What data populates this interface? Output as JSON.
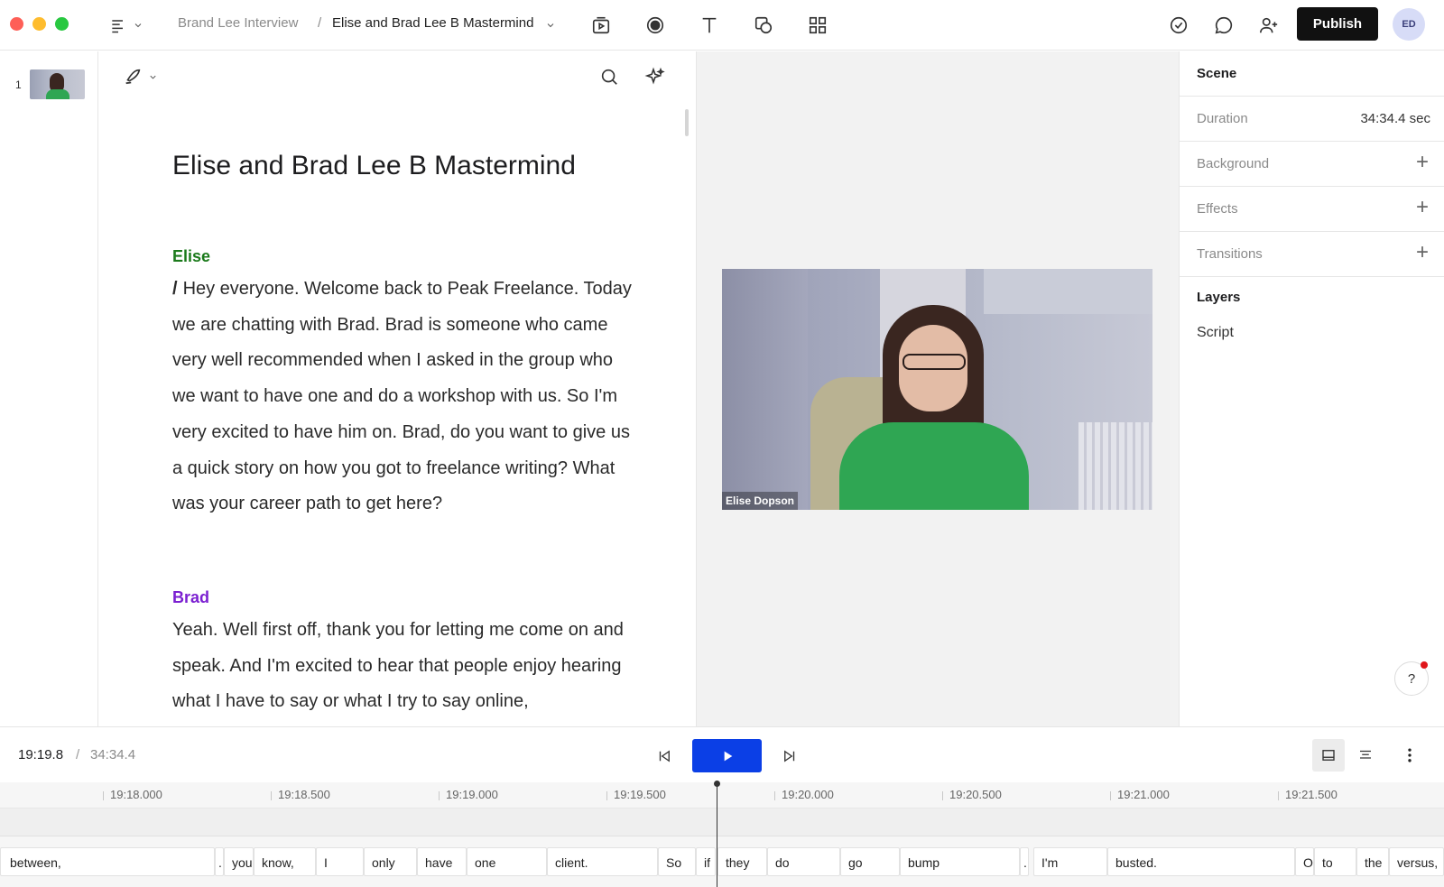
{
  "header": {
    "project": "Brand Lee Interview",
    "separator": "/",
    "document": "Elise and Brad Lee B Mastermind",
    "publish_label": "Publish",
    "avatar_initials": "ED"
  },
  "scenes": [
    {
      "number": "1"
    }
  ],
  "script": {
    "title": "Elise and Brad Lee B Mastermind",
    "blocks": [
      {
        "speaker": "Elise",
        "speaker_color": "#1b7a1b",
        "marker": "/",
        "text": "Hey everyone. Welcome back to Peak Freelance. Today we are chatting with Brad. Brad is someone who came very well recommended when I asked in the group who we want to have one and do a workshop with us. So I'm very excited to have him on. Brad, do you want to give us a quick story on how you got to freelance writing? What was your career path to get here?"
      },
      {
        "speaker": "Brad",
        "speaker_color": "#7b1fd1",
        "text": "Yeah. Well first off, thank you for letting me come on and speak. And I'm excited to hear that people enjoy hearing what I have to say or what I try to say online,"
      }
    ]
  },
  "preview": {
    "name_tag": "Elise Dopson"
  },
  "panel": {
    "scene_heading": "Scene",
    "duration_label": "Duration",
    "duration_value": "34:34.4 sec",
    "background_label": "Background",
    "effects_label": "Effects",
    "transitions_label": "Transitions",
    "layers_heading": "Layers",
    "layers": [
      "Script"
    ],
    "help_label": "?"
  },
  "transport": {
    "current_time": "19:19.8",
    "separator": "/",
    "total_time": "34:34.4"
  },
  "timeline": {
    "ticks": [
      "19:18.000",
      "19:18.500",
      "19:19.000",
      "19:19.500",
      "19:20.000",
      "19:20.500",
      "19:21.000",
      "19:21.500"
    ],
    "words": [
      "between,",
      ".",
      "you",
      "know,",
      "I",
      "only",
      "have",
      "one",
      "client.",
      "So",
      "if",
      "they",
      "do",
      "go",
      "bump",
      ".",
      "I'm",
      "busted.",
      "O",
      "to",
      "the",
      "versus,"
    ]
  },
  "colors": {
    "accent": "#0b3fe6",
    "publish_bg": "#111111",
    "elise": "#1b7a1b",
    "brad": "#7b1fd1",
    "notification": "#e0161b"
  }
}
